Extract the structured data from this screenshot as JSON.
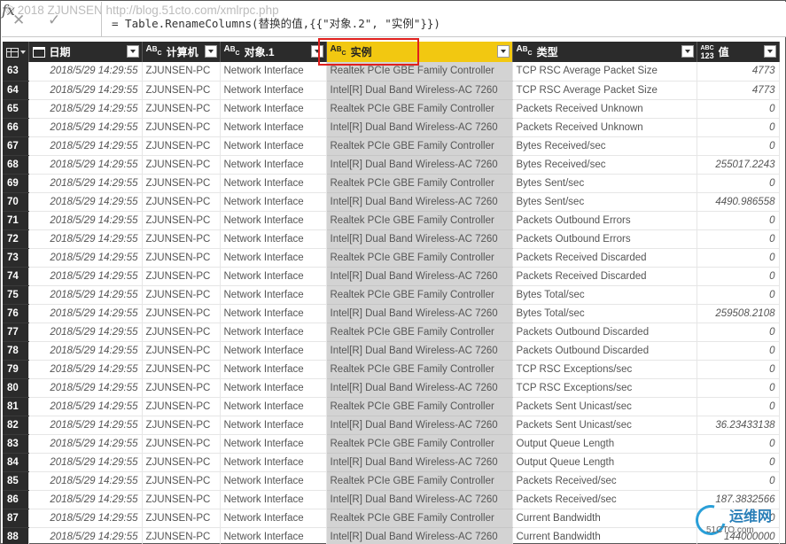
{
  "watermark": "© 2018 ZJUNSEN http://blog.51cto.com/xmlrpc.php",
  "formula_bar": {
    "cancel_glyph": "✕",
    "commit_glyph": "✓",
    "fx_label": "fx",
    "formula": "= Table.RenameColumns(替换的值,{{\"对象.2\", \"实例\"}})"
  },
  "columns": [
    {
      "label": "日期",
      "type_icon": "calendar-clock-icon"
    },
    {
      "label": "计算机",
      "type_icon": "text-type-icon"
    },
    {
      "label": "对象.1",
      "type_icon": "text-type-icon"
    },
    {
      "label": "实例",
      "type_icon": "text-type-icon",
      "selected": true
    },
    {
      "label": "类型",
      "type_icon": "text-type-icon"
    },
    {
      "label": "值",
      "type_icon": "any-type-icon"
    }
  ],
  "type_icon_text": {
    "a": "A",
    "b": "B",
    "c": "C",
    "any_top": "ABC",
    "any_bottom": "123"
  },
  "rows": [
    {
      "n": "63",
      "date": "2018/5/29 14:29:55",
      "pc": "ZJUNSEN-PC",
      "obj": "Network Interface",
      "inst": "Realtek PCIe GBE Family Controller",
      "type": "TCP RSC Average Packet Size",
      "val": "4773"
    },
    {
      "n": "64",
      "date": "2018/5/29 14:29:55",
      "pc": "ZJUNSEN-PC",
      "obj": "Network Interface",
      "inst": "Intel[R] Dual Band Wireless-AC 7260",
      "type": "TCP RSC Average Packet Size",
      "val": "4773"
    },
    {
      "n": "65",
      "date": "2018/5/29 14:29:55",
      "pc": "ZJUNSEN-PC",
      "obj": "Network Interface",
      "inst": "Realtek PCIe GBE Family Controller",
      "type": "Packets Received Unknown",
      "val": "0"
    },
    {
      "n": "66",
      "date": "2018/5/29 14:29:55",
      "pc": "ZJUNSEN-PC",
      "obj": "Network Interface",
      "inst": "Intel[R] Dual Band Wireless-AC 7260",
      "type": "Packets Received Unknown",
      "val": "0"
    },
    {
      "n": "67",
      "date": "2018/5/29 14:29:55",
      "pc": "ZJUNSEN-PC",
      "obj": "Network Interface",
      "inst": "Realtek PCIe GBE Family Controller",
      "type": "Bytes Received/sec",
      "val": "0"
    },
    {
      "n": "68",
      "date": "2018/5/29 14:29:55",
      "pc": "ZJUNSEN-PC",
      "obj": "Network Interface",
      "inst": "Intel[R] Dual Band Wireless-AC 7260",
      "type": "Bytes Received/sec",
      "val": "255017.2243"
    },
    {
      "n": "69",
      "date": "2018/5/29 14:29:55",
      "pc": "ZJUNSEN-PC",
      "obj": "Network Interface",
      "inst": "Realtek PCIe GBE Family Controller",
      "type": "Bytes Sent/sec",
      "val": "0"
    },
    {
      "n": "70",
      "date": "2018/5/29 14:29:55",
      "pc": "ZJUNSEN-PC",
      "obj": "Network Interface",
      "inst": "Intel[R] Dual Band Wireless-AC 7260",
      "type": "Bytes Sent/sec",
      "val": "4490.986558"
    },
    {
      "n": "71",
      "date": "2018/5/29 14:29:55",
      "pc": "ZJUNSEN-PC",
      "obj": "Network Interface",
      "inst": "Realtek PCIe GBE Family Controller",
      "type": "Packets Outbound Errors",
      "val": "0"
    },
    {
      "n": "72",
      "date": "2018/5/29 14:29:55",
      "pc": "ZJUNSEN-PC",
      "obj": "Network Interface",
      "inst": "Intel[R] Dual Band Wireless-AC 7260",
      "type": "Packets Outbound Errors",
      "val": "0"
    },
    {
      "n": "73",
      "date": "2018/5/29 14:29:55",
      "pc": "ZJUNSEN-PC",
      "obj": "Network Interface",
      "inst": "Realtek PCIe GBE Family Controller",
      "type": "Packets Received Discarded",
      "val": "0"
    },
    {
      "n": "74",
      "date": "2018/5/29 14:29:55",
      "pc": "ZJUNSEN-PC",
      "obj": "Network Interface",
      "inst": "Intel[R] Dual Band Wireless-AC 7260",
      "type": "Packets Received Discarded",
      "val": "0"
    },
    {
      "n": "75",
      "date": "2018/5/29 14:29:55",
      "pc": "ZJUNSEN-PC",
      "obj": "Network Interface",
      "inst": "Realtek PCIe GBE Family Controller",
      "type": "Bytes Total/sec",
      "val": "0"
    },
    {
      "n": "76",
      "date": "2018/5/29 14:29:55",
      "pc": "ZJUNSEN-PC",
      "obj": "Network Interface",
      "inst": "Intel[R] Dual Band Wireless-AC 7260",
      "type": "Bytes Total/sec",
      "val": "259508.2108"
    },
    {
      "n": "77",
      "date": "2018/5/29 14:29:55",
      "pc": "ZJUNSEN-PC",
      "obj": "Network Interface",
      "inst": "Realtek PCIe GBE Family Controller",
      "type": "Packets Outbound Discarded",
      "val": "0"
    },
    {
      "n": "78",
      "date": "2018/5/29 14:29:55",
      "pc": "ZJUNSEN-PC",
      "obj": "Network Interface",
      "inst": "Intel[R] Dual Band Wireless-AC 7260",
      "type": "Packets Outbound Discarded",
      "val": "0"
    },
    {
      "n": "79",
      "date": "2018/5/29 14:29:55",
      "pc": "ZJUNSEN-PC",
      "obj": "Network Interface",
      "inst": "Realtek PCIe GBE Family Controller",
      "type": "TCP RSC Exceptions/sec",
      "val": "0"
    },
    {
      "n": "80",
      "date": "2018/5/29 14:29:55",
      "pc": "ZJUNSEN-PC",
      "obj": "Network Interface",
      "inst": "Intel[R] Dual Band Wireless-AC 7260",
      "type": "TCP RSC Exceptions/sec",
      "val": "0"
    },
    {
      "n": "81",
      "date": "2018/5/29 14:29:55",
      "pc": "ZJUNSEN-PC",
      "obj": "Network Interface",
      "inst": "Realtek PCIe GBE Family Controller",
      "type": "Packets Sent Unicast/sec",
      "val": "0"
    },
    {
      "n": "82",
      "date": "2018/5/29 14:29:55",
      "pc": "ZJUNSEN-PC",
      "obj": "Network Interface",
      "inst": "Intel[R] Dual Band Wireless-AC 7260",
      "type": "Packets Sent Unicast/sec",
      "val": "36.23433138"
    },
    {
      "n": "83",
      "date": "2018/5/29 14:29:55",
      "pc": "ZJUNSEN-PC",
      "obj": "Network Interface",
      "inst": "Realtek PCIe GBE Family Controller",
      "type": "Output Queue Length",
      "val": "0"
    },
    {
      "n": "84",
      "date": "2018/5/29 14:29:55",
      "pc": "ZJUNSEN-PC",
      "obj": "Network Interface",
      "inst": "Intel[R] Dual Band Wireless-AC 7260",
      "type": "Output Queue Length",
      "val": "0"
    },
    {
      "n": "85",
      "date": "2018/5/29 14:29:55",
      "pc": "ZJUNSEN-PC",
      "obj": "Network Interface",
      "inst": "Realtek PCIe GBE Family Controller",
      "type": "Packets Received/sec",
      "val": "0"
    },
    {
      "n": "86",
      "date": "2018/5/29 14:29:55",
      "pc": "ZJUNSEN-PC",
      "obj": "Network Interface",
      "inst": "Intel[R] Dual Band Wireless-AC 7260",
      "type": "Packets Received/sec",
      "val": "187.3832566"
    },
    {
      "n": "87",
      "date": "2018/5/29 14:29:55",
      "pc": "ZJUNSEN-PC",
      "obj": "Network Interface",
      "inst": "Realtek PCIe GBE Family Controller",
      "type": "Current Bandwidth",
      "val": "0"
    },
    {
      "n": "88",
      "date": "2018/5/29 14:29:55",
      "pc": "ZJUNSEN-PC",
      "obj": "Network Interface",
      "inst": "Intel[R] Dual Band Wireless-AC 7260",
      "type": "Current Bandwidth",
      "val": "144000000"
    }
  ],
  "logo": {
    "title": "运维网",
    "subtitle": "51CTO.com",
    "icon": "logo-swirl-icon"
  },
  "colors": {
    "selected_header": "#f2c811",
    "highlight_border": "#e0201e",
    "selected_column": "#d3d3d3",
    "header_bg": "#2b2b2b"
  }
}
